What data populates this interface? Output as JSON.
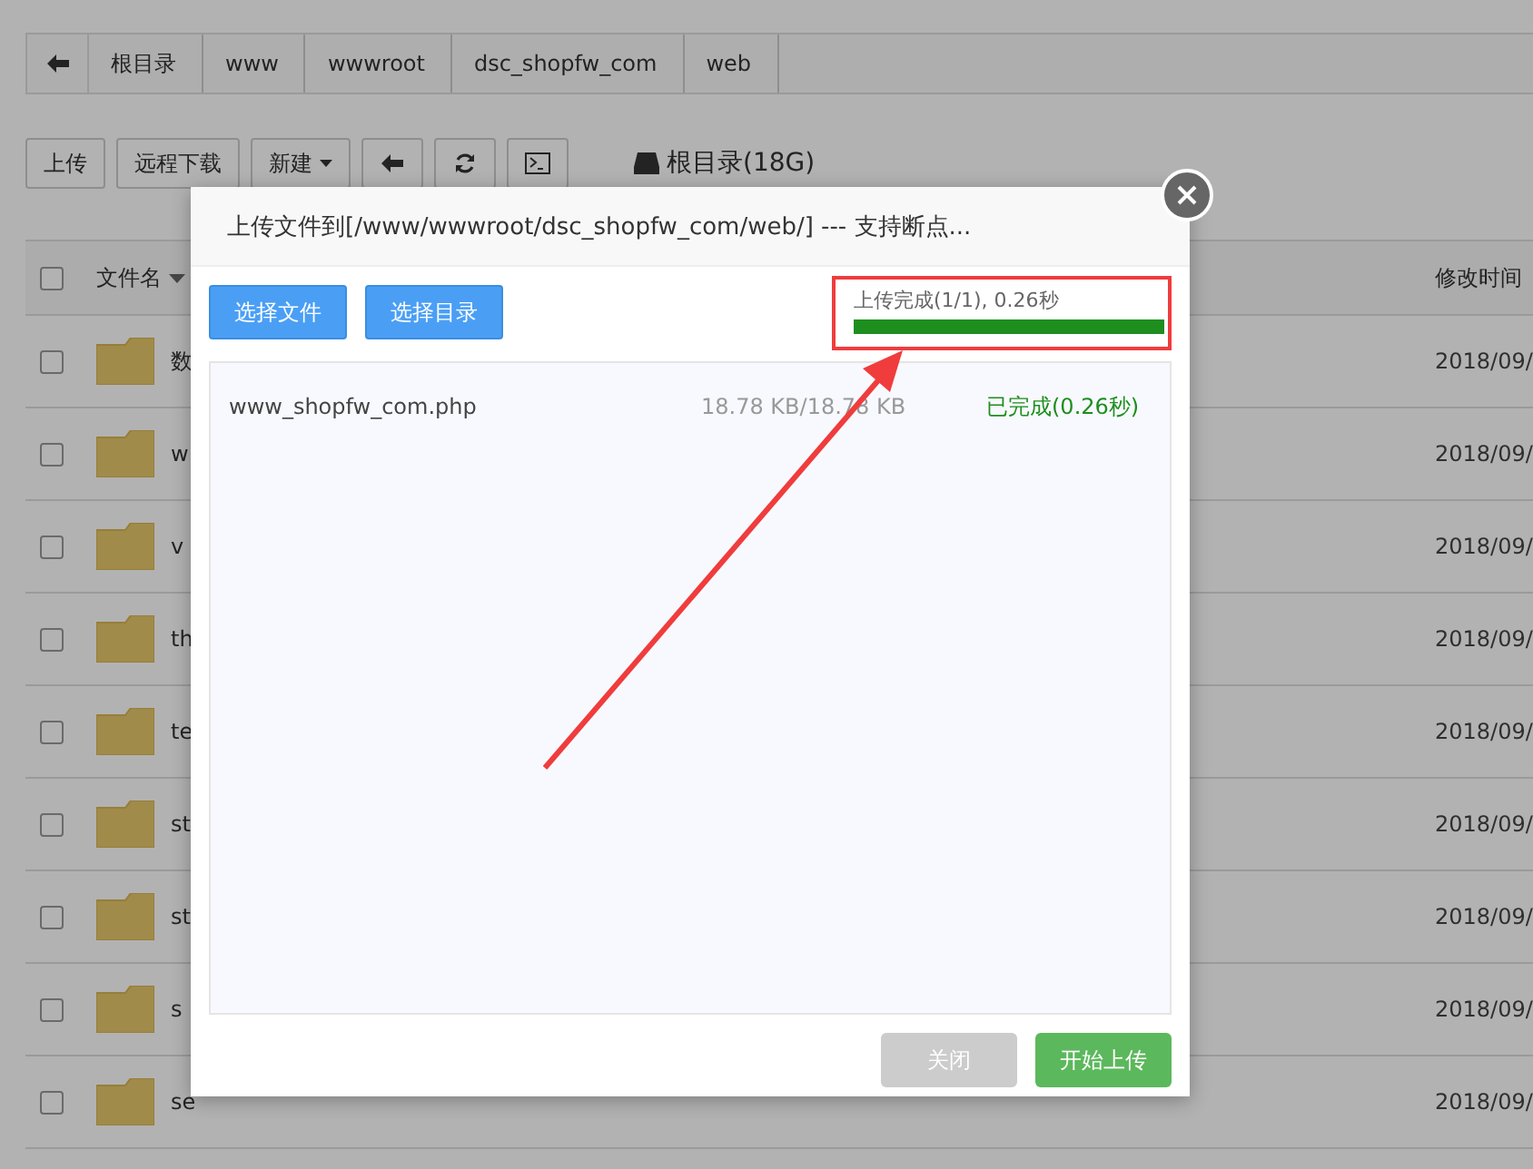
{
  "breadcrumb": {
    "items": [
      "根目录",
      "www",
      "wwwroot",
      "dsc_shopfw_com",
      "web"
    ]
  },
  "toolbar": {
    "buttons": [
      {
        "label": "上传",
        "kind": "text"
      },
      {
        "label": "远程下载",
        "kind": "text"
      },
      {
        "label": "新建",
        "kind": "dropdown"
      },
      {
        "kind": "back"
      },
      {
        "kind": "refresh"
      },
      {
        "kind": "terminal"
      }
    ],
    "disk": "根目录(18G)"
  },
  "table": {
    "columns": [
      "文件名",
      "修改时间"
    ],
    "all_checked": false,
    "rows": [
      {
        "name": "数",
        "modified": "2018/09/",
        "checked": false
      },
      {
        "name": "w",
        "modified": "2018/09/",
        "checked": false
      },
      {
        "name": "v",
        "modified": "2018/09/",
        "checked": false
      },
      {
        "name": "th",
        "modified": "2018/09/",
        "checked": false
      },
      {
        "name": "te",
        "modified": "2018/09/",
        "checked": false
      },
      {
        "name": "st",
        "modified": "2018/09/",
        "checked": false
      },
      {
        "name": "st",
        "modified": "2018/09/",
        "checked": false
      },
      {
        "name": "s",
        "modified": "2018/09/",
        "checked": false
      },
      {
        "name": "se",
        "modified": "2018/09/",
        "checked": false
      }
    ]
  },
  "dialog": {
    "title": "上传文件到[/www/wwwroot/dsc_shopfw_com/web/] --- 支持断点...",
    "pick_buttons": [
      "选择文件",
      "选择目录"
    ],
    "progress": {
      "text": "上传完成(1/1), 0.26秒",
      "level": 1
    },
    "files": [
      {
        "name": "www_shopfw_com.php",
        "size": "18.78 KB/18.78 KB",
        "status": "已完成(0.26秒)"
      }
    ],
    "footer_buttons": [
      {
        "label": "关闭",
        "kind": "secondary"
      },
      {
        "label": "开始上传",
        "kind": "primary"
      }
    ]
  }
}
